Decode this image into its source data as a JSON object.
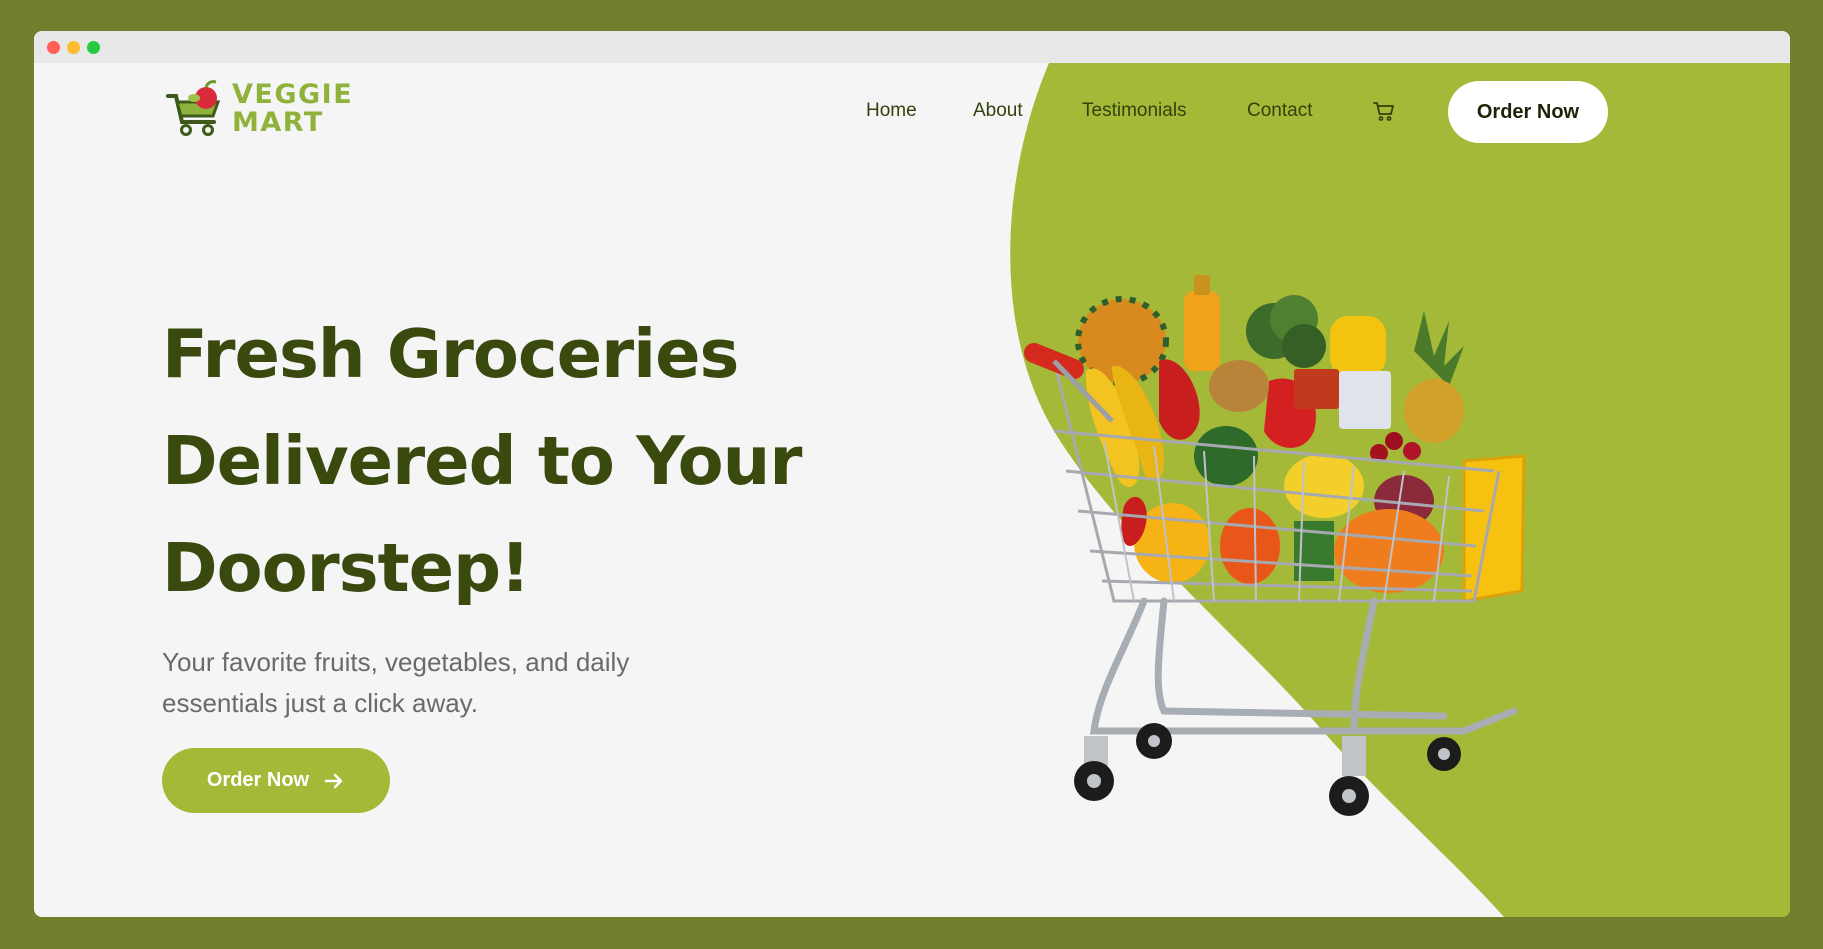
{
  "brand": {
    "line1": "VEGGIE",
    "line2": "MART",
    "accent": "#8fb33a"
  },
  "nav": {
    "links": [
      "Home",
      "About",
      "Testimonials",
      "Contact"
    ],
    "cart_icon": "shopping-cart-icon",
    "order_label": "Order Now"
  },
  "hero": {
    "title_line1": "Fresh Groceries",
    "title_line2": "Delivered to Your",
    "title_line3": "Doorstep!",
    "subtitle": "Your favorite fruits, vegetables, and daily essentials just a click away.",
    "cta_label": "Order Now",
    "cta_icon": "arrow-right-icon"
  },
  "colors": {
    "page_bg": "#747f2d",
    "panel_green": "#a5b938",
    "heading": "#3a4a0e",
    "content_bg": "#f5f5f5"
  }
}
